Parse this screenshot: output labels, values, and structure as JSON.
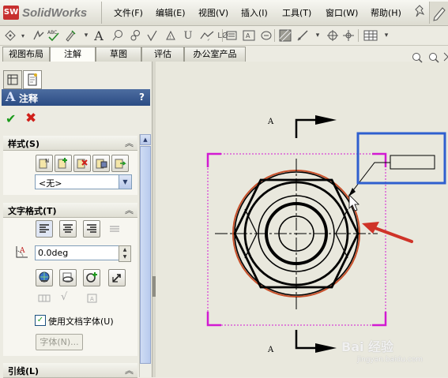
{
  "app": {
    "name": "SolidWorks",
    "logo_text": "SW"
  },
  "menu": [
    "文件(F)",
    "编辑(E)",
    "视图(V)",
    "插入(I)",
    "工具(T)",
    "窗口(W)",
    "帮助(H)"
  ],
  "command_tabs": [
    "视图布局",
    "注解",
    "草图",
    "评估",
    "办公室产品"
  ],
  "active_tab": "注解",
  "property_manager": {
    "title": "注释",
    "title_icon": "A",
    "help": "?",
    "ok_glyph": "✔",
    "cancel_glyph": "✖",
    "style_section": {
      "label": "样式(S)",
      "selected": "<无>"
    },
    "text_format_section": {
      "label": "文字格式(T)",
      "angle": "0.0deg",
      "use_doc_font_label": "使用文档字体(U)",
      "use_doc_font_checked": true,
      "font_button": "字体(N)..."
    },
    "leader_section": {
      "label": "引线(L)"
    }
  },
  "drawing": {
    "section_label_top": "A",
    "section_label_bottom": "A"
  },
  "watermark": {
    "text": "Bai 经验",
    "url": "jingyan.baidu.com"
  },
  "colors": {
    "accent_blue": "#2f5fcf",
    "arrow_red": "#cf3328",
    "bbox_magenta": "#d21ad2"
  }
}
